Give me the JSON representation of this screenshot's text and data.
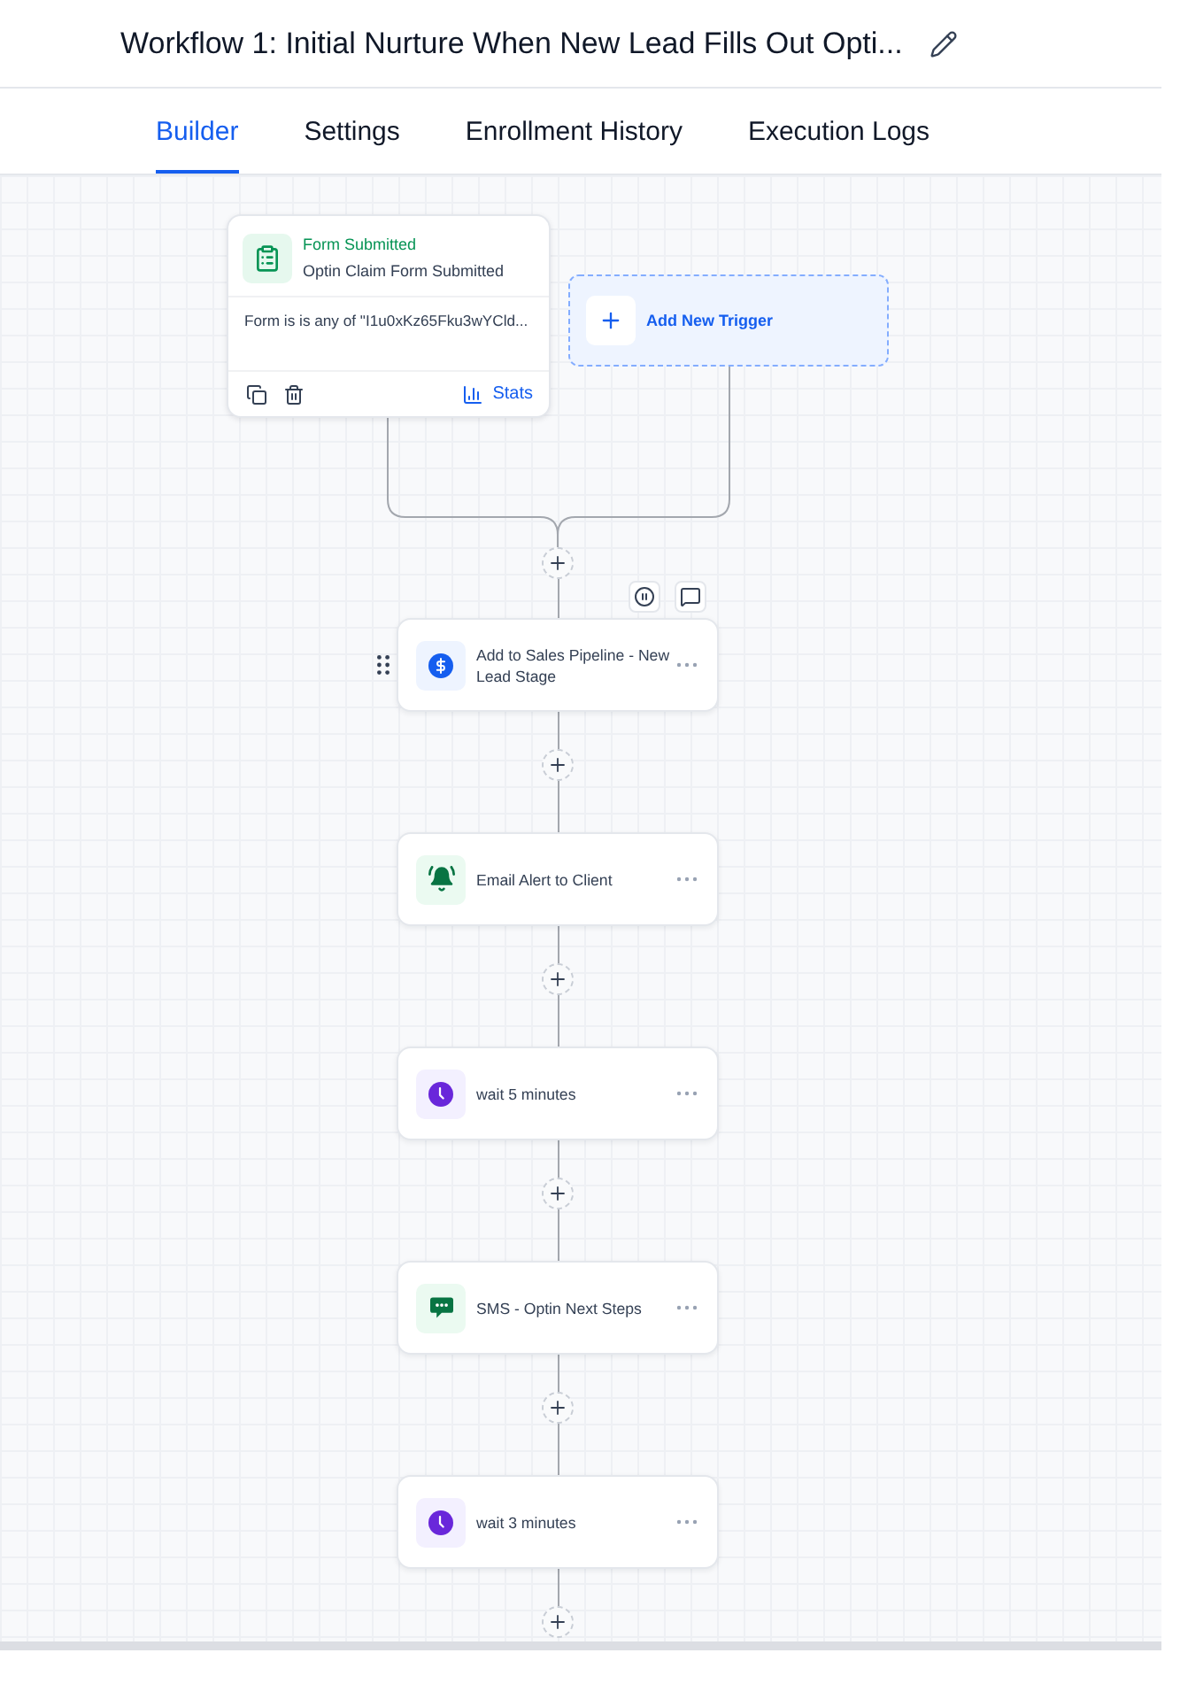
{
  "header": {
    "title": "Workflow 1: Initial Nurture When New Lead Fills Out Opti..."
  },
  "tabs": [
    {
      "label": "Builder",
      "selected": true
    },
    {
      "label": "Settings",
      "selected": false
    },
    {
      "label": "Enrollment History",
      "selected": false
    },
    {
      "label": "Execution Logs",
      "selected": false
    }
  ],
  "triggers": [
    {
      "kind": "form",
      "title": "Form Submitted",
      "subtitle": "Optin Claim Form Submitted",
      "condition": "Form is is any of \"I1u0xKz65Fku3wYCld...",
      "stats_label": "Stats"
    }
  ],
  "add_trigger": {
    "label": "Add New Trigger"
  },
  "actions": [
    {
      "kind": "pipeline",
      "label": "Add to Sales Pipeline - New Lead Stage",
      "hovered": true
    },
    {
      "kind": "email_alert",
      "label": "Email Alert to Client",
      "hovered": false
    },
    {
      "kind": "wait",
      "label": "wait 5 minutes",
      "hovered": false
    },
    {
      "kind": "sms",
      "label": "SMS - Optin Next Steps",
      "hovered": false
    },
    {
      "kind": "wait",
      "label": "wait 3 minutes",
      "hovered": false
    }
  ]
}
